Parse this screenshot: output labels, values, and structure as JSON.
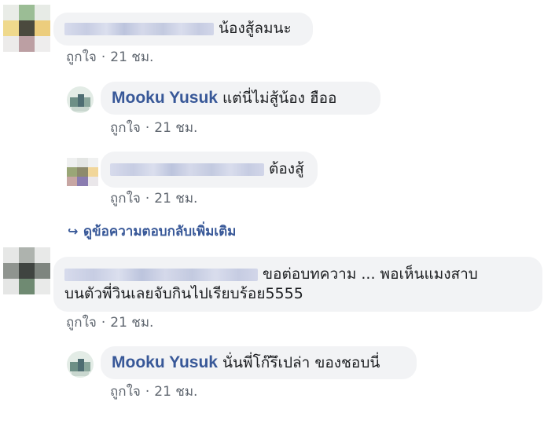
{
  "time_sep": "·",
  "comments": [
    {
      "text": "น้องสู้ลมนะ",
      "like": "ถูกใจ",
      "time": "21 ชม."
    },
    {
      "author": "Mooku Yusuk",
      "text": "แต่นี่ไม่สู้น้อง ฮืออ",
      "like": "ถูกใจ",
      "time": "21 ชม."
    },
    {
      "text": "ต้องสู้",
      "like": "ถูกใจ",
      "time": "21 ชม."
    },
    {
      "text_line1": "ขอต่อบทความ ... พอเห็นแมงสาบ",
      "text_line2": "บนตัวพี่วินเลยจับกินไปเรียบร้อย5555",
      "like": "ถูกใจ",
      "time": "21 ชม."
    },
    {
      "author": "Mooku Yusuk",
      "text": "นั่นพี่โก๊รึเปล่า ของชอบนี่",
      "like": "ถูกใจ",
      "time": "21 ชม."
    }
  ],
  "view_more_replies": "ดูข้อความตอบกลับเพิ่มเติม"
}
